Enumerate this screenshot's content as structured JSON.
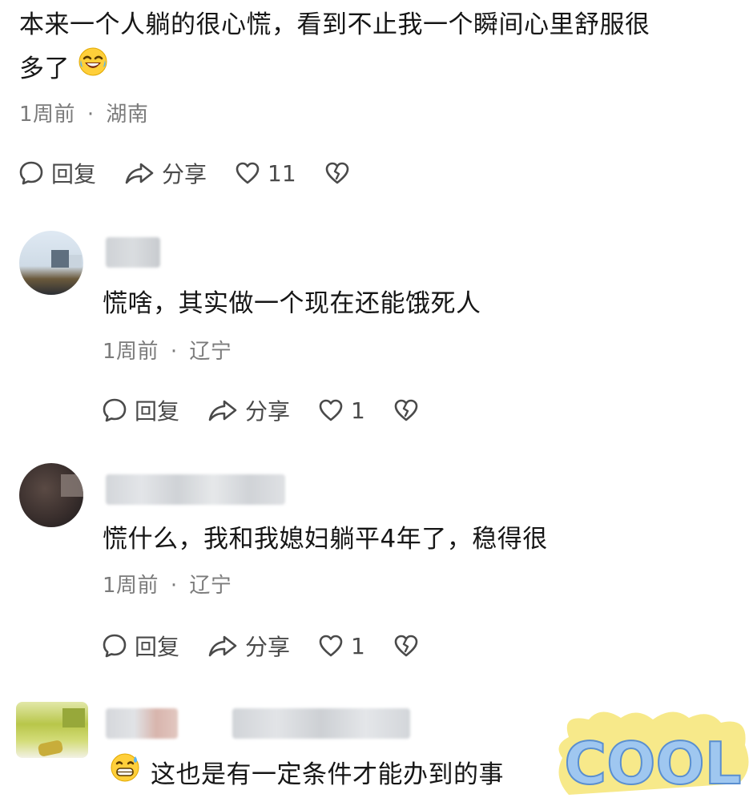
{
  "main_comment": {
    "text_line1": "本来一个人躺的很心慌，看到不止我一个瞬间心里舒服很",
    "text_line2": "多了",
    "time": "1周前",
    "location": "湖南",
    "reply_label": "回复",
    "share_label": "分享",
    "like_count": "11"
  },
  "replies": [
    {
      "text": "慌啥，其实做一个现在还能饿死人",
      "time": "1周前",
      "location": "辽宁",
      "reply_label": "回复",
      "share_label": "分享",
      "like_count": "1"
    },
    {
      "text": "慌什么，我和我媳妇躺平4年了，稳得很",
      "time": "1周前",
      "location": "辽宁",
      "reply_label": "回复",
      "share_label": "分享",
      "like_count": "1"
    },
    {
      "text": "这也是有一定条件才能办到的事"
    }
  ],
  "meta_separator": "·",
  "sticker_text": "COOL",
  "icons": {
    "reply": "comment-bubble-icon",
    "share": "share-arrow-icon",
    "like": "heart-icon",
    "dislike": "broken-heart-icon",
    "emoji_laugh_cry": "laugh-cry-emoji-icon",
    "emoji_grin_sweat": "grin-sweat-emoji-icon"
  },
  "colors": {
    "text_primary": "#161616",
    "text_meta": "#7b7b7b",
    "icon": "#4a4a4a"
  }
}
